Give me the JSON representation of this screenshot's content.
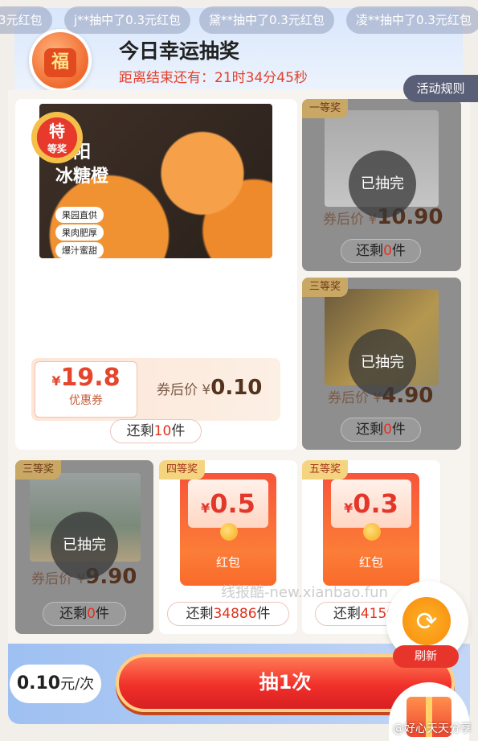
{
  "ticker": [
    "3元红包",
    "j**抽中了0.3元红包",
    "黛**抽中了0.3元红包",
    "凌**抽中了0.3元红包"
  ],
  "header": {
    "badge_char": "福",
    "title": "今日幸运抽奖",
    "countdown": "距离结束还有：21时34分45秒",
    "rules_button": "活动规则"
  },
  "prizes": {
    "special": {
      "badge_top": "特",
      "badge_bottom": "等奖",
      "img_title_line1": "麻阳",
      "img_title_line2": "冰糖橙",
      "features": [
        "果园直供",
        "果肉肥厚",
        "爆汁蜜甜"
      ],
      "coupon_symbol": "¥",
      "coupon_amount": "19.8",
      "coupon_label": "优惠券",
      "price_label": "券后价",
      "price_symbol": "¥",
      "price": "0.10",
      "remain_prefix": "还剩",
      "remain_count": "10",
      "remain_suffix": "件"
    },
    "first": {
      "tag": "一等奖",
      "status": "已抽完",
      "price_label": "券后价",
      "price_symbol": "¥",
      "price": "10.90",
      "remain_prefix": "还剩",
      "remain_count": "0",
      "remain_suffix": "件"
    },
    "third_a": {
      "tag": "三等奖",
      "status": "已抽完",
      "price_label": "券后价",
      "price_symbol": "¥",
      "price": "4.90",
      "remain_prefix": "还剩",
      "remain_count": "0",
      "remain_suffix": "件"
    },
    "third_b": {
      "tag": "三等奖",
      "status": "已抽完",
      "price_label": "券后价",
      "price_symbol": "¥",
      "price": "9.90",
      "remain_prefix": "还剩",
      "remain_count": "0",
      "remain_suffix": "件"
    },
    "fourth": {
      "tag": "四等奖",
      "symbol": "¥",
      "amount": "0.5",
      "label": "红包",
      "remain_prefix": "还剩",
      "remain_count": "34886",
      "remain_suffix": "件"
    },
    "fifth": {
      "tag": "五等奖",
      "symbol": "¥",
      "amount": "0.3",
      "label": "红包",
      "remain_prefix": "还剩",
      "remain_count": "4150",
      "remain_suffix": "件"
    }
  },
  "watermark": "线报酷-new.xianbao.fun",
  "footer": {
    "unit_price_value": "0.10",
    "unit_price_suffix": "元/次",
    "draw_button": "抽1次",
    "refresh_label": "刷新",
    "credit": "@好心天天分享"
  },
  "colors": {
    "accent_red": "#e4372b",
    "soldout_gray": "#8e8e8e",
    "tag_gold": "#f5d480"
  },
  "icons": [
    "lucky-bag-icon",
    "refresh-icon",
    "gift-icon"
  ]
}
